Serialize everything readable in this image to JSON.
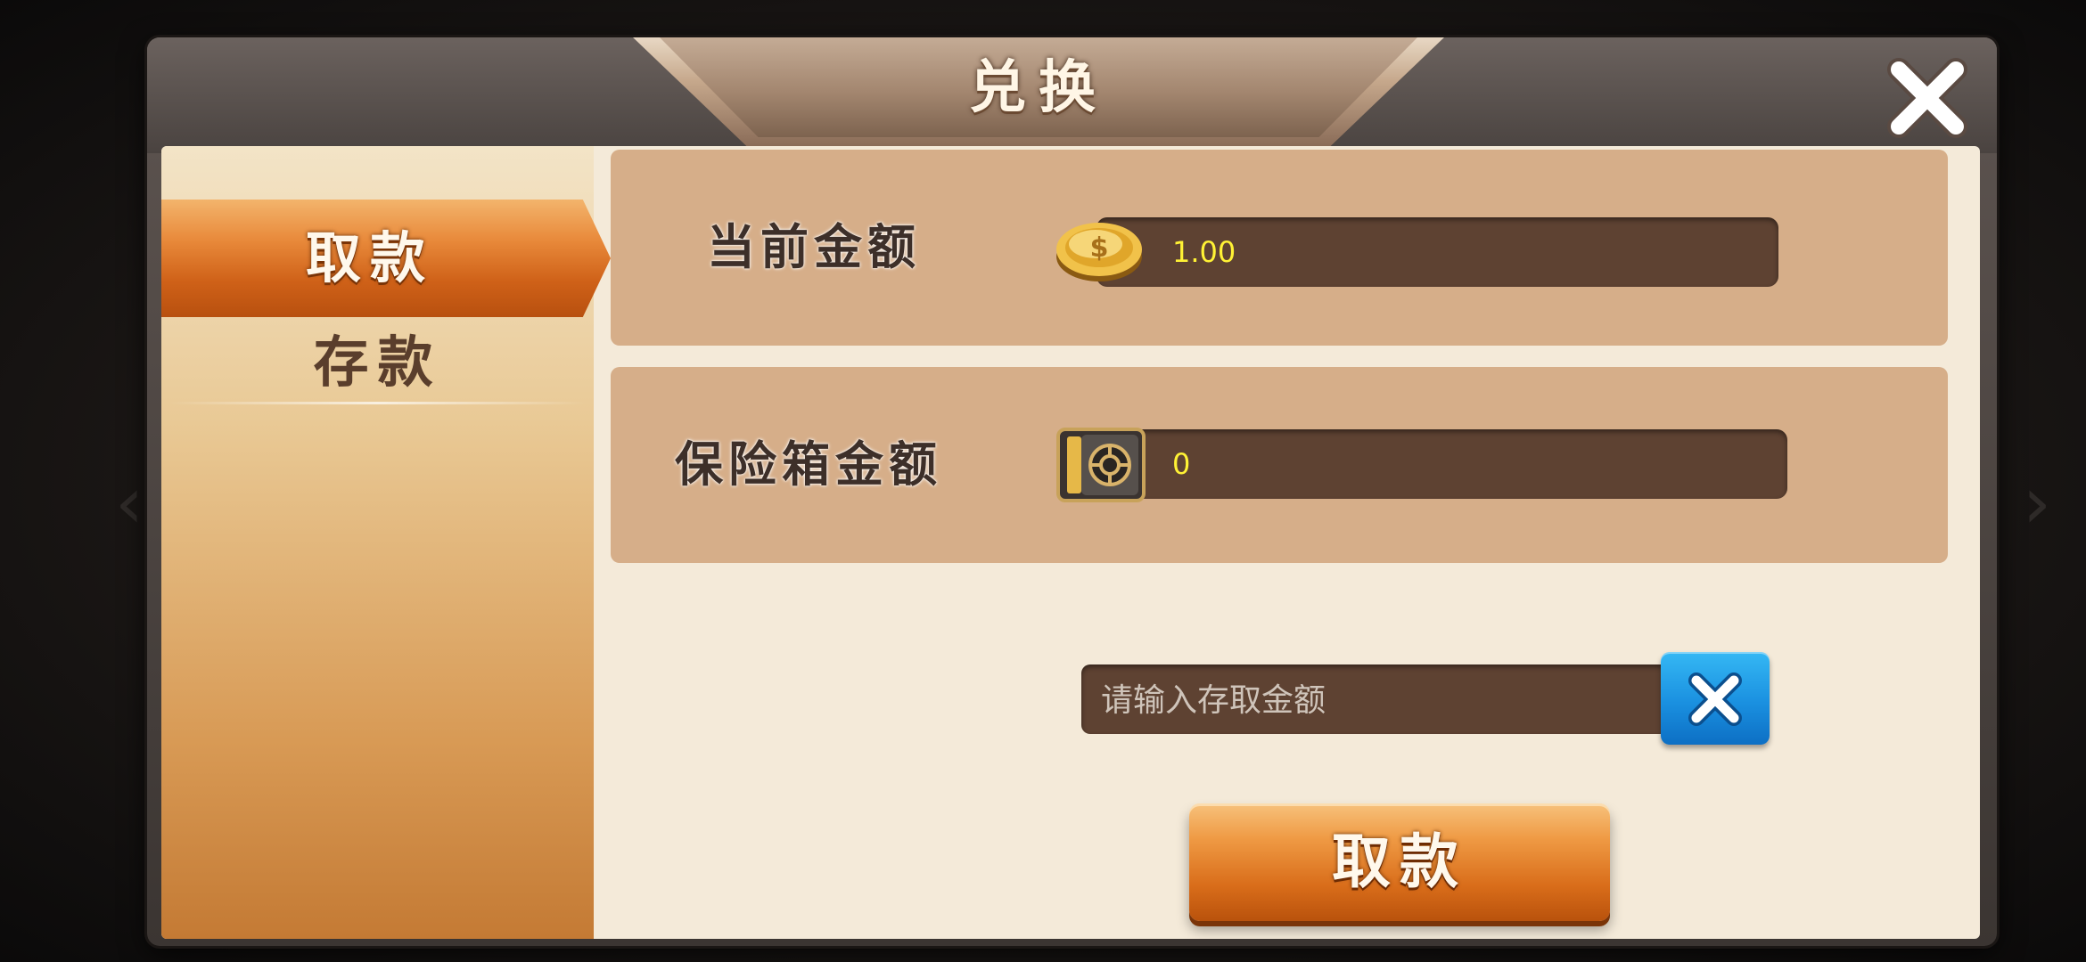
{
  "dialog": {
    "title": "兑换",
    "close_icon": "close-icon"
  },
  "sidebar": {
    "tabs": [
      {
        "label": "取款",
        "active": true
      },
      {
        "label": "存款",
        "active": false
      }
    ]
  },
  "main": {
    "current_amount": {
      "label": "当前金额",
      "value": "1.00",
      "icon": "gold-coin-icon"
    },
    "safe_amount": {
      "label": "保险箱金额",
      "value": "0",
      "icon": "safe-box-icon"
    },
    "amount_input": {
      "placeholder": "请输入存取金额",
      "value": ""
    },
    "clear_icon": "clear-icon",
    "submit_label": "取款"
  },
  "colors": {
    "accent_orange": "#e8893a",
    "value_yellow": "#fff235",
    "panel_tan": "#d6ae89",
    "clear_blue": "#1a90e0"
  }
}
